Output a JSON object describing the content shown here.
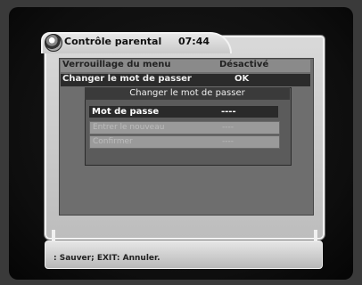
{
  "header": {
    "title": "Contrôle parental",
    "time": "07:44"
  },
  "menu": {
    "items": [
      {
        "label": "Verrouillage du menu",
        "value": "Désactivé"
      },
      {
        "label": "Changer le mot de passer",
        "value": "OK"
      }
    ]
  },
  "dialog": {
    "title": "Changer le mot de passer",
    "fields": [
      {
        "label": "Mot de passe",
        "value": "----"
      },
      {
        "label": "Entrer le nouveau",
        "value": "----"
      },
      {
        "label": "Confirmer",
        "value": "----"
      }
    ]
  },
  "footer": {
    "help_text": ": Sauver; EXIT: Annuler."
  }
}
